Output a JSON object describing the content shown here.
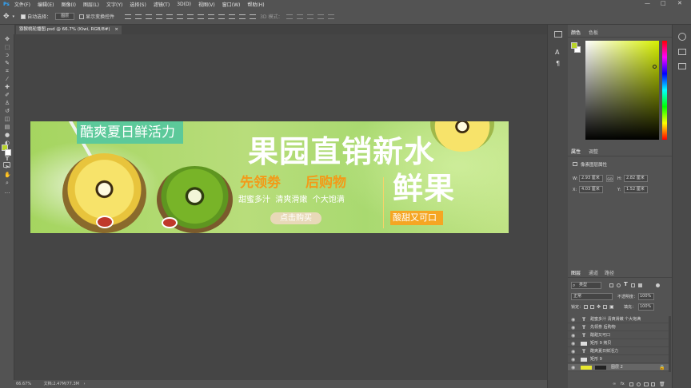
{
  "menu": [
    "文件(F)",
    "编辑(E)",
    "图像(I)",
    "图层(L)",
    "文字(Y)",
    "选择(S)",
    "滤镜(T)",
    "3D(D)",
    "视图(V)",
    "窗口(W)",
    "帮助(H)"
  ],
  "options": {
    "auto_select_label": "自动选择：",
    "auto_select_value": "图层",
    "transform_label": "显示变换控件",
    "mode3d_label": "3D 模式："
  },
  "document": {
    "tab_title": "猕猴桃轮播图.psd @ 66.7% (Kiwi, RGB/8#)",
    "zoom": "66.67%",
    "doc_info": "文档:2.47M/77.3M"
  },
  "banner": {
    "tag": "酷爽夏日鲜活力",
    "headline1": "果园直销新水",
    "headline2": "鲜果",
    "sub_left": "先领劵",
    "sub_right": "后购物",
    "tagline": "甜蜜多汁  清爽滑嫩  个大饱满",
    "button": "点击购买",
    "badge": "酸甜又可口"
  },
  "color_panel": {
    "tabs": [
      "颜色",
      "色板"
    ],
    "fg": "#b8d42a",
    "bg": "#ffffff",
    "hue": "#d6f000"
  },
  "properties_panel": {
    "tabs": [
      "属性",
      "调整"
    ],
    "section": "像素图层属性",
    "w_label": "W:",
    "w_value": "2.93 厘米",
    "h_label": "H:",
    "h_value": "2.82 厘米",
    "x_label": "X:",
    "x_value": "4.03 厘米",
    "y_label": "Y:",
    "y_value": "1.52 厘米",
    "link": "GO"
  },
  "layers_panel": {
    "tabs": [
      "图层",
      "通道",
      "路径"
    ],
    "filter": "类型",
    "blend": "正常",
    "opacity_label": "不透明度：",
    "opacity": "100%",
    "lock_label": "锁定：",
    "fill_label": "填充：",
    "fill": "100%",
    "layers": [
      {
        "type": "T",
        "name": "甜蜜多汁  清爽滑嫩  个大饱满"
      },
      {
        "type": "T",
        "name": "先领劵  后购物"
      },
      {
        "type": "T",
        "name": "酸甜又可口"
      },
      {
        "type": "shape",
        "name": "矩形 9 拷贝"
      },
      {
        "type": "T",
        "name": "酷爽夏日鲜活力"
      },
      {
        "type": "shape",
        "name": "矩形 9"
      },
      {
        "type": "pixel",
        "name": "图层 2"
      }
    ]
  }
}
